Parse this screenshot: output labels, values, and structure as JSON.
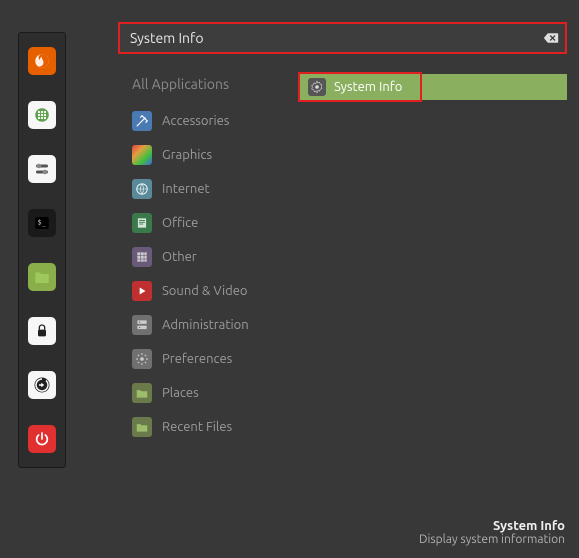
{
  "search": {
    "value": "System Info"
  },
  "categories": {
    "header": "All Applications",
    "items": [
      {
        "label": "Accessories"
      },
      {
        "label": "Graphics"
      },
      {
        "label": "Internet"
      },
      {
        "label": "Office"
      },
      {
        "label": "Other"
      },
      {
        "label": "Sound & Video"
      },
      {
        "label": "Administration"
      },
      {
        "label": "Preferences"
      },
      {
        "label": "Places"
      },
      {
        "label": "Recent Files"
      }
    ]
  },
  "results": {
    "items": [
      {
        "label": "System Info"
      }
    ]
  },
  "footer": {
    "title": "System Info",
    "desc": "Display system information"
  },
  "colors": {
    "highlight_red": "#e02020",
    "selection_green": "#8aaf5f"
  }
}
